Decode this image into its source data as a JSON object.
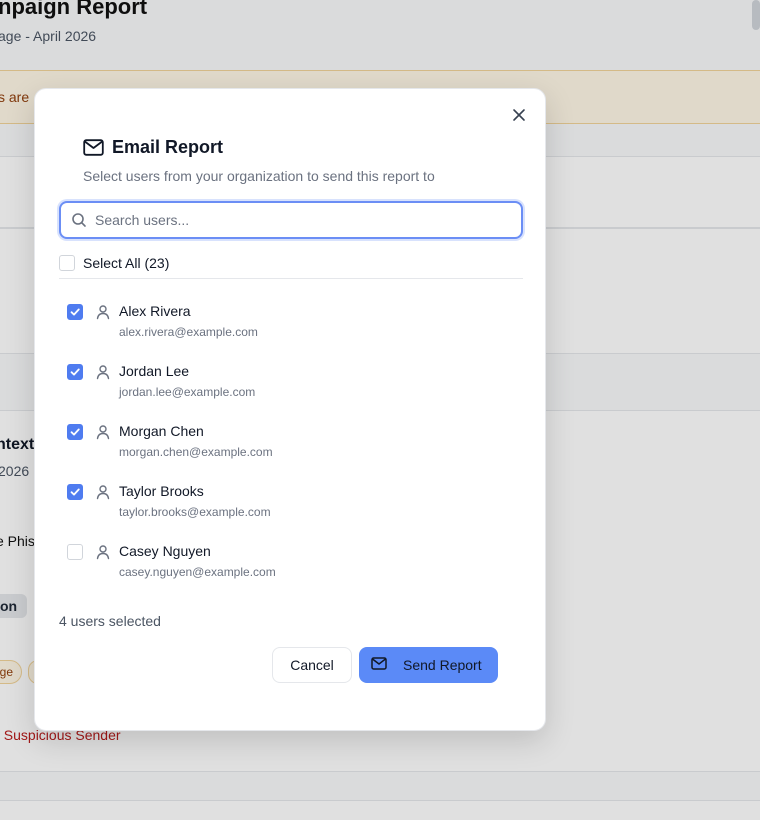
{
  "background": {
    "title": "npaign Report",
    "subtitle": "age - April 2026",
    "banner_text": "s are",
    "section_title": "ntext",
    "section_date": "2026",
    "phis_text": "e Phis",
    "chip_text": "on",
    "tag_text": "ge",
    "reasons_text": ", Suspicious Sender"
  },
  "modal": {
    "title": "Email Report",
    "description": "Select users from your organization to send this report to",
    "search_placeholder": "Search users...",
    "select_all_label": "Select All (23)",
    "users": [
      {
        "name": "Alex Rivera",
        "email": "alex.rivera@example.com",
        "checked": true
      },
      {
        "name": "Jordan Lee",
        "email": "jordan.lee@example.com",
        "checked": true
      },
      {
        "name": "Morgan Chen",
        "email": "morgan.chen@example.com",
        "checked": true
      },
      {
        "name": "Taylor Brooks",
        "email": "taylor.brooks@example.com",
        "checked": true
      },
      {
        "name": "Casey Nguyen",
        "email": "casey.nguyen@example.com",
        "checked": false
      }
    ],
    "selected_count": "4 users selected",
    "cancel_label": "Cancel",
    "send_label": "Send Report"
  },
  "icons": {
    "close": "close-icon",
    "mail": "mail-icon",
    "search": "search-icon",
    "user": "user-icon",
    "check": "check-icon"
  },
  "colors": {
    "accent": "#5b8af7",
    "checkbox_checked": "#4f7cf0",
    "warning_bg": "#fff7e6",
    "danger_text": "#b91c1c"
  }
}
